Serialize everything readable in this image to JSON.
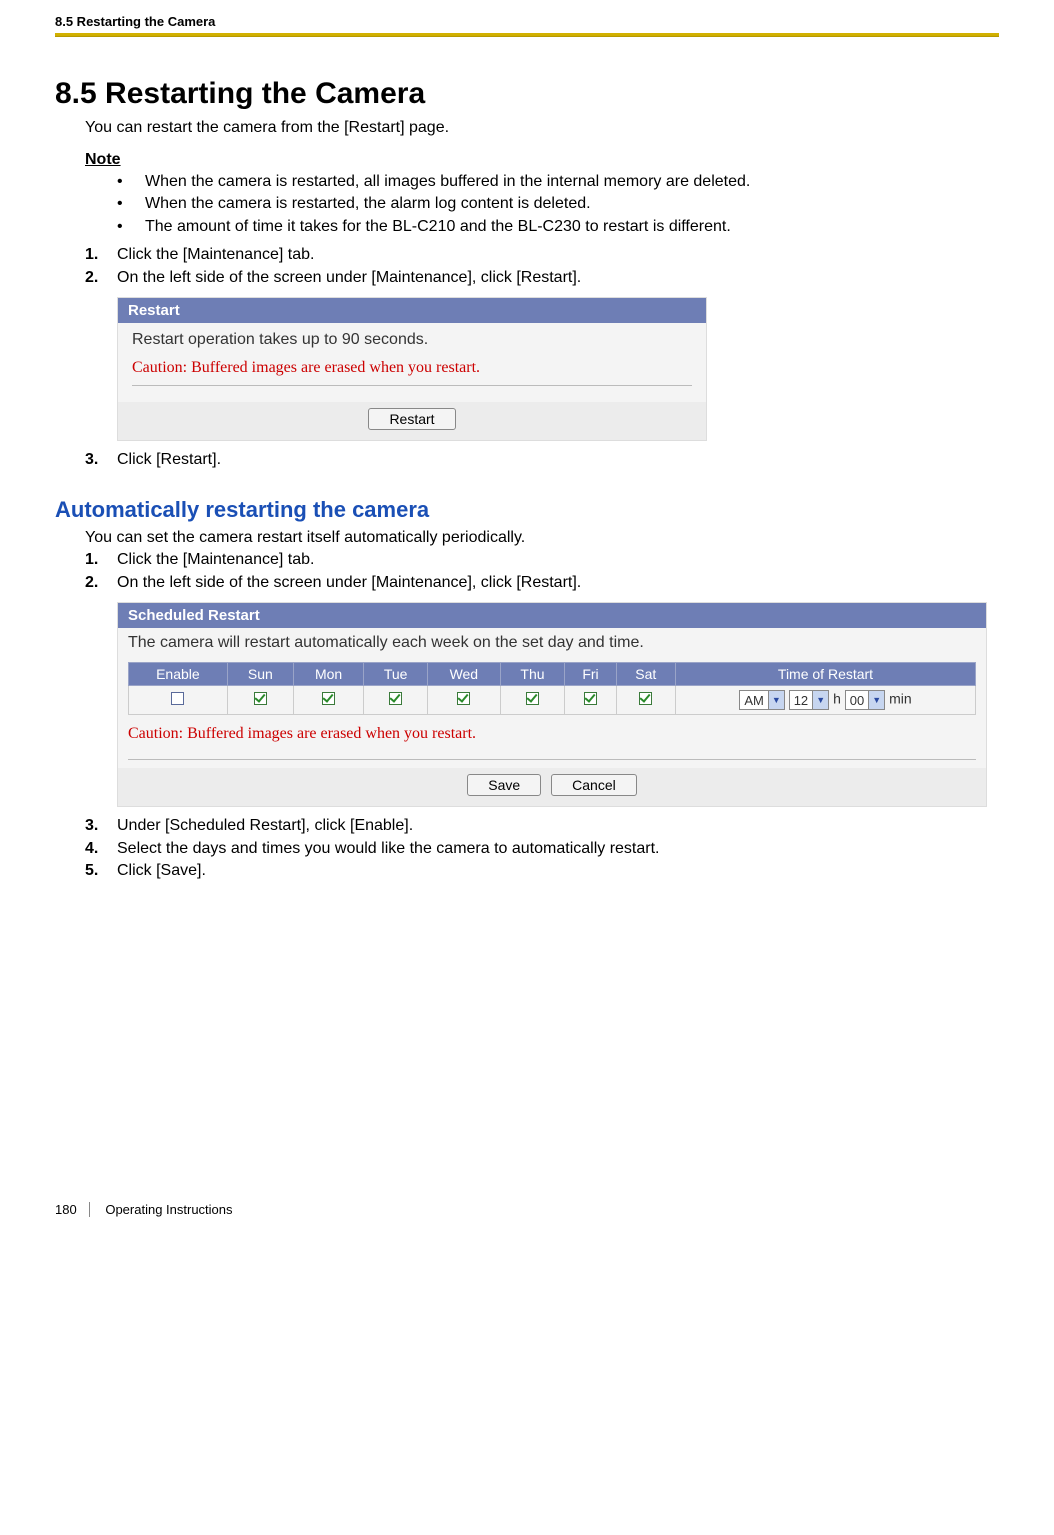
{
  "header": {
    "running_title": "8.5 Restarting the Camera"
  },
  "section": {
    "number_title": "8.5  Restarting the Camera"
  },
  "intro": "You can restart the camera from the [Restart] page.",
  "note": {
    "label": "Note",
    "items": [
      "When the camera is restarted, all images buffered in the internal memory are deleted.",
      "When the camera is restarted, the alarm log content is deleted.",
      "The amount of time it takes for the BL-C210 and the BL-C230 to restart is different."
    ]
  },
  "steps1": {
    "s1": {
      "num": "1.",
      "text": "Click the [Maintenance] tab."
    },
    "s2": {
      "num": "2.",
      "text": "On the left side of the screen under [Maintenance], click [Restart]."
    },
    "s3": {
      "num": "3.",
      "text": "Click [Restart]."
    }
  },
  "restart_panel": {
    "title": "Restart",
    "msg": "Restart operation takes up to 90 seconds.",
    "caution": "Caution: Buffered images are erased when you restart.",
    "button": "Restart"
  },
  "subsection": {
    "title": "Automatically restarting the camera"
  },
  "intro2": "You can set the camera restart itself automatically periodically.",
  "steps2": {
    "s1": {
      "num": "1.",
      "text": "Click the [Maintenance] tab."
    },
    "s2": {
      "num": "2.",
      "text": "On the left side of the screen under [Maintenance], click [Restart]."
    },
    "s3": {
      "num": "3.",
      "text": "Under [Scheduled Restart], click [Enable]."
    },
    "s4": {
      "num": "4.",
      "text": "Select the days and times you would like the camera to automatically restart."
    },
    "s5": {
      "num": "5.",
      "text": "Click [Save]."
    }
  },
  "sched_panel": {
    "title": "Scheduled Restart",
    "desc": "The camera will restart automatically each week on the set day and time.",
    "headers": {
      "enable": "Enable",
      "sun": "Sun",
      "mon": "Mon",
      "tue": "Tue",
      "wed": "Wed",
      "thu": "Thu",
      "fri": "Fri",
      "sat": "Sat",
      "tor": "Time of Restart"
    },
    "checks": {
      "enable": false,
      "sun": true,
      "mon": true,
      "tue": true,
      "wed": true,
      "thu": true,
      "fri": true,
      "sat": true
    },
    "time": {
      "ampm": "AM",
      "hour": "12",
      "h_label": "h",
      "min": "00",
      "min_label": "min"
    },
    "caution": "Caution: Buffered images are erased when you restart.",
    "save": "Save",
    "cancel": "Cancel"
  },
  "footer": {
    "page": "180",
    "doc": "Operating Instructions"
  }
}
